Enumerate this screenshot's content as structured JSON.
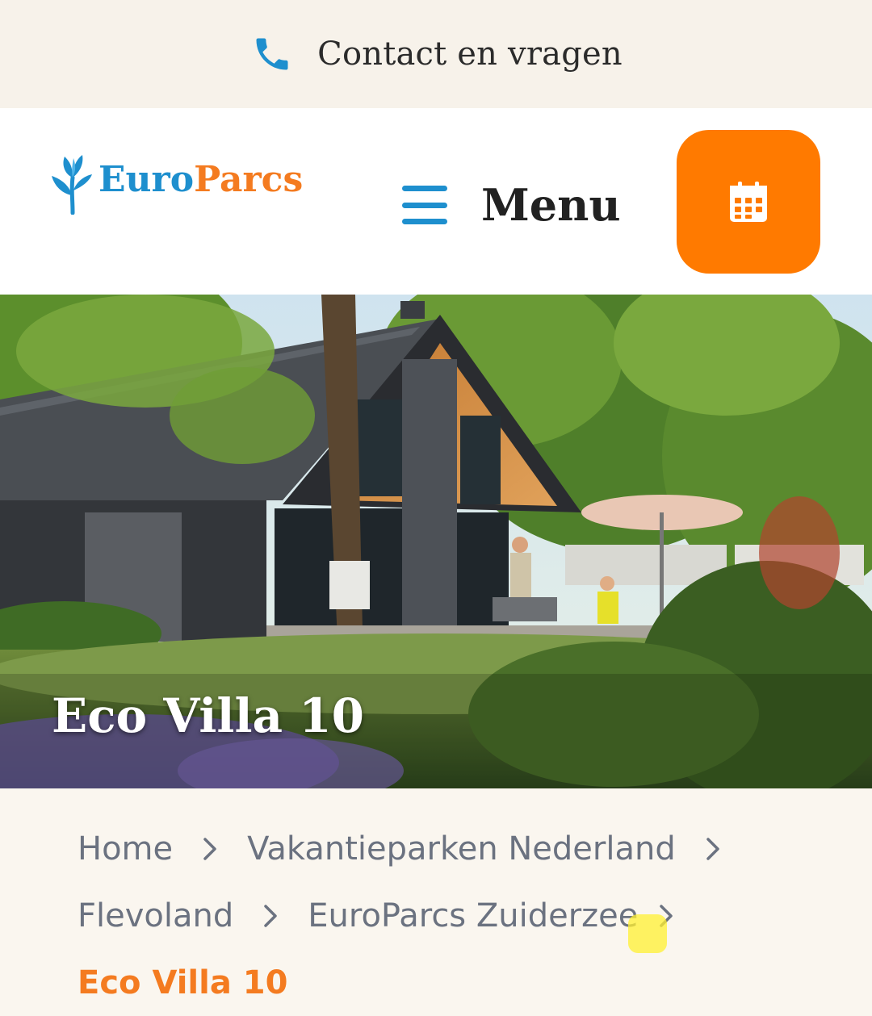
{
  "topbar": {
    "contact_label": "Contact en vragen",
    "icon": "phone-icon"
  },
  "header": {
    "logo": {
      "part1": "Euro",
      "part2": "Parcs"
    },
    "menu_label": "Menu",
    "calendar_icon": "calendar-icon"
  },
  "hero": {
    "title": "Eco Villa 10"
  },
  "breadcrumb": {
    "items": [
      "Home",
      "Vakantieparken Nederland",
      "Flevoland",
      "EuroParcs Zuiderzee"
    ],
    "current": "Eco Villa 10"
  },
  "colors": {
    "brand_blue": "#1e8fce",
    "brand_orange": "#f47b20",
    "button_orange": "#ff7a00",
    "topbar_bg": "#f7f2ea",
    "breadcrumb_text": "#6b7280"
  }
}
